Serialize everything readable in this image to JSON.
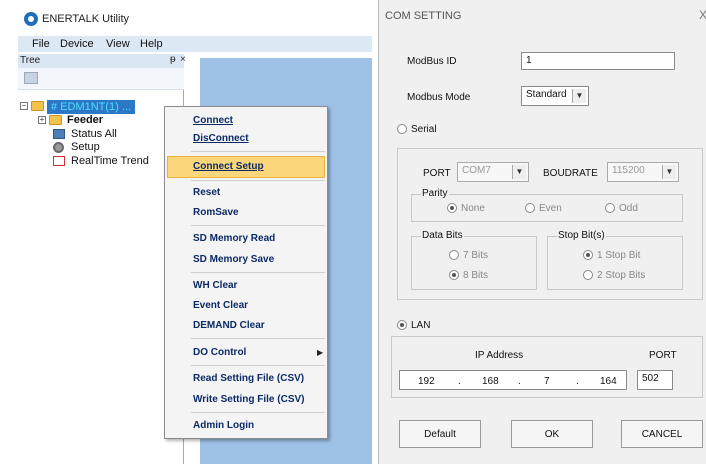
{
  "app": {
    "title": "ENERTALK Utility"
  },
  "menu": {
    "file": "File",
    "device": "Device",
    "view": "View",
    "help": "Help"
  },
  "tree": {
    "header": "Tree",
    "pin": "ᵽ",
    "close": "×",
    "root": "# EDM1NT(1) ...",
    "items": {
      "feeder": "Feeder",
      "status_all": "Status All",
      "setup": "Setup",
      "realtime_trend": "RealTime Trend"
    }
  },
  "context_menu": {
    "connect": "Connect",
    "disconnect": "DisConnect",
    "connect_setup": "Connect Setup",
    "reset": "Reset",
    "romsave": "RomSave",
    "sd_memory_read": "SD Memory Read",
    "sd_memory_save": "SD Memory Save",
    "wh_clear": "WH Clear",
    "event_clear": "Event Clear",
    "demand_clear": "DEMAND Clear",
    "do_control": "DO Control",
    "read_setting": "Read Setting File (CSV)",
    "write_setting": "Write Setting File (CSV)",
    "admin_login": "Admin Login"
  },
  "dialog": {
    "title": "COM SETTING",
    "close": "X",
    "modbus_id_label": "ModBus ID",
    "modbus_id_value": "1",
    "modbus_mode_label": "Modbus Mode",
    "modbus_mode_value": "Standard",
    "serial_label": "Serial",
    "port_label": "PORT",
    "port_value": "COM7",
    "boudrate_label": "BOUDRATE",
    "boudrate_value": "115200",
    "parity_label": "Parity",
    "parity_none": "None",
    "parity_even": "Even",
    "parity_odd": "Odd",
    "data_bits_label": "Data Bits",
    "data_7": "7 Bits",
    "data_8": "8 Bits",
    "stop_bits_label": "Stop Bit(s)",
    "stop_1": "1 Stop Bit",
    "stop_2": "2 Stop Bits",
    "lan_label": "LAN",
    "ip_address_label": "IP Address",
    "port2_label": "PORT",
    "ip": [
      "192",
      "168",
      "7",
      "164"
    ],
    "ip_dot": ".",
    "port2_value": "502",
    "default_button": "Default",
    "ok_button": "OK",
    "cancel_button": "CANCEL"
  }
}
